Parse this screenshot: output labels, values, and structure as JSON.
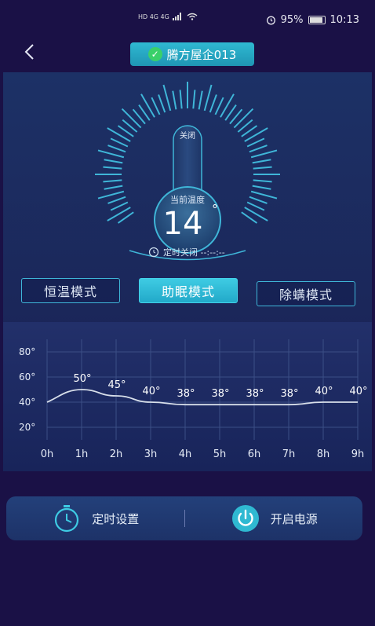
{
  "status_bar": {
    "network": "HD 4G 4G",
    "battery": "95%",
    "time": "10:13"
  },
  "header": {
    "device_name": "腾方屋企013",
    "back_icon": "chevron-left-icon",
    "status_icon": "check-circle-icon"
  },
  "gauge": {
    "top_label": "关闭",
    "current_label": "当前温度",
    "current_temp": "14",
    "degree_symbol": "°",
    "timer_text": "定时关闭 --:--:--"
  },
  "modes": [
    {
      "label": "恒温模式",
      "active": false
    },
    {
      "label": "助眠模式",
      "active": true
    },
    {
      "label": "除螨模式",
      "active": false
    }
  ],
  "chart_data": {
    "type": "line",
    "x": [
      "0h",
      "1h",
      "2h",
      "3h",
      "4h",
      "5h",
      "6h",
      "7h",
      "8h",
      "9h"
    ],
    "series": [
      {
        "values": [
          null,
          50,
          45,
          40,
          38,
          38,
          38,
          38,
          40,
          40
        ]
      }
    ],
    "point_labels": [
      "",
      "50°",
      "45°",
      "40°",
      "38°",
      "38°",
      "38°",
      "38°",
      "40°",
      "40°"
    ],
    "y_ticks": [
      "80°",
      "60°",
      "40°",
      "20°"
    ],
    "ylim": [
      10,
      90
    ],
    "grid": true,
    "colors": {
      "line": "#d8dfea",
      "grid": "#3b4f86"
    }
  },
  "bottom": {
    "timer_label": "定时设置",
    "power_label": "开启电源"
  },
  "colors": {
    "accent": "#2fb9d2",
    "background": "#1a1146",
    "panel": "#1c3166"
  }
}
